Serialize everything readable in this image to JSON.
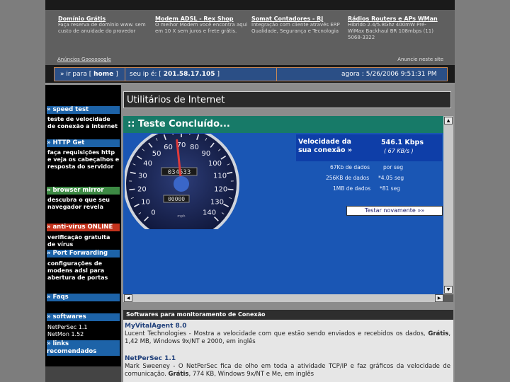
{
  "ads": [
    {
      "title": "Domínio Grátis",
      "text": "Faça reserva de domínio www. sem custo de anuidade do provedor"
    },
    {
      "title": "Modem ADSL - Rex Shop",
      "text": "O melhor Modem você encontra aqui em 10 X sem juros e frete grátis."
    },
    {
      "title": "Somat Contadores - RJ",
      "text": "Integração com cliente através ERP Qualidade, Segurança e Tecnologia"
    },
    {
      "title": "Rádios Routers e APs WMan",
      "text": "Hibrido 2.4/5.8Ghz 400mW Pré-WiMax Backhaul BR 108mbps (11) 5068-3322"
    }
  ],
  "ad_links": {
    "left": "Anúncios Goooooogle",
    "right": "Anuncie neste site"
  },
  "ipbar": {
    "goto_prefix": "» ir para [",
    "home": "home",
    "goto_suffix": "]",
    "ip_label": "seu ip é: [",
    "ip": "201.58.17.105",
    "ip_suffix": "]",
    "now_label": "agora :",
    "now": "5/26/2006 9:51:31 PM"
  },
  "sidebar": [
    {
      "heading": "» speed test",
      "desc": "teste de velocidade de conexão a internet",
      "color": "blue"
    },
    {
      "heading": "» HTTP Get",
      "desc": "faça requisições http e veja os cabeçalhos e resposta do servidor",
      "color": "blue"
    },
    {
      "heading": "» browser mirror",
      "desc": "descubra o que seu navegador revela",
      "color": "green"
    },
    {
      "heading": "» anti-virus ONLINE",
      "desc": "verificação gratuita de vírus",
      "color": "red"
    },
    {
      "heading": "» Port Forwarding",
      "desc": "configurações de modens adsl para abertura de portas",
      "color": "blue"
    },
    {
      "heading": "» Faqs",
      "desc": "",
      "color": "blue"
    },
    {
      "heading": "» softwares",
      "desc": "",
      "color": "blue",
      "items": [
        "NetPerSec 1.1",
        "NetMon 1.52"
      ]
    },
    {
      "heading": "» links recomendados",
      "desc": "",
      "color": "blue"
    }
  ],
  "page_title": "Utilitários de Internet",
  "test": {
    "header": ":: Teste Concluído...",
    "speed_label": "Velocidade da sua conexão »",
    "speed_value": "546.1 Kbps",
    "speed_sub": "( 67 KB/s )",
    "rows": [
      {
        "size": "67Kb de dados",
        "time": "por seg"
      },
      {
        "size": "256KB de dados",
        "time": "*4.05 seg"
      },
      {
        "size": "1MB de dados",
        "time": "*81 seg"
      }
    ],
    "button": "Testar novamente »»",
    "gauge": {
      "min": 0,
      "max": 140,
      "value": 67,
      "odometer": "034533",
      "trip": "00000",
      "unit": "mph",
      "ticks": [
        "0",
        "10",
        "20",
        "30",
        "40",
        "50",
        "60",
        "70",
        "80",
        "90",
        "100",
        "110",
        "120",
        "130",
        "140"
      ]
    }
  },
  "software": {
    "heading": "Softwares para monitoramento de Conexão",
    "items": [
      {
        "name": "MyVitalAgent 8.0",
        "desc": "Lucent Technologies - Mostra a velocidade com que estão sendo enviados e recebidos os dados,",
        "desc_bold": "Grátis",
        "desc_tail": ", 1,42 MB, Windows 9x/NT e 2000, em inglês"
      },
      {
        "name": "NetPerSec 1.1",
        "desc": "Mark Sweeney - O NetPerSec fica de olho em toda a atividade TCP/IP e faz gráficos da velocidade de comunicação.",
        "desc_bold": "Grátis",
        "desc_tail": ", 774 KB, Windows 9x/NT e Me, em inglês"
      }
    ]
  },
  "colors": {
    "accent": "#1d63a8",
    "green": "#3d8a44",
    "red": "#c4331d",
    "teal": "#177a68"
  }
}
